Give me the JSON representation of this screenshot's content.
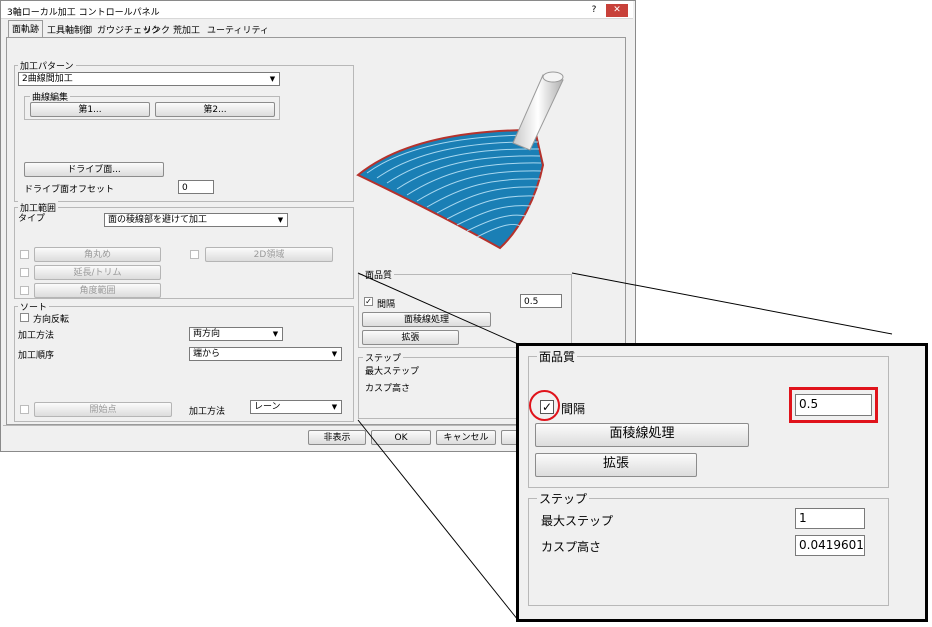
{
  "window": {
    "title": "3軸ローカル加工 コントロールパネル",
    "help_btn": "?",
    "close_btn": "✕"
  },
  "tabs": [
    "面軌跡",
    "工具軸制御",
    "ガウジチェック",
    "リンク",
    "荒加工",
    "ユーティリティ"
  ],
  "pattern": {
    "group": "加工パターン",
    "select_value": "2曲線間加工",
    "curve_group": "曲線編集",
    "first_btn": "第1...",
    "second_btn": "第2...",
    "drive_btn": "ドライブ面...",
    "drive_offset_label": "ドライブ面オフセット",
    "drive_offset_value": "0"
  },
  "range": {
    "group": "加工範囲",
    "type_label": "タイプ",
    "type_value": "面の稜線部を避けて加工",
    "corner_btn": "角丸め",
    "region2d_btn": "2D領域",
    "extend_btn": "延長/トリム",
    "angle_btn": "角度範囲"
  },
  "sort": {
    "group": "ソート",
    "reverse_label": "方向反転",
    "method_label": "加工方法",
    "method_value": "両方向",
    "order_label": "加工順序",
    "order_value": "端から",
    "start_btn": "開始点",
    "method2_label": "加工方法",
    "method2_value": "レーン"
  },
  "quality": {
    "group": "面品質",
    "interval_label": "間隔",
    "interval_value": "0.5",
    "edge_btn": "面稜線処理",
    "expand_btn": "拡張"
  },
  "step": {
    "group": "ステップ",
    "max_label": "最大ステップ",
    "cusp_label": "カスプ高さ"
  },
  "footer": {
    "hide": "非表示",
    "ok": "OK",
    "cancel": "キャンセル"
  },
  "zoom": {
    "quality_group": "面品質",
    "interval_label": "間隔",
    "interval_value": "0.5",
    "edge_btn": "面稜線処理",
    "expand_btn": "拡張",
    "step_group": "ステップ",
    "max_label": "最大ステップ",
    "max_value": "1",
    "cusp_label": "カスプ高さ",
    "cusp_value": "0.0419601"
  },
  "colors": {
    "highlight": "#e0131b",
    "surface": "#1a7fb5",
    "surface_edge": "#b5322c"
  },
  "icons": {
    "checkbox_checked": "check-icon",
    "dropdown": "chevron-down-icon"
  }
}
